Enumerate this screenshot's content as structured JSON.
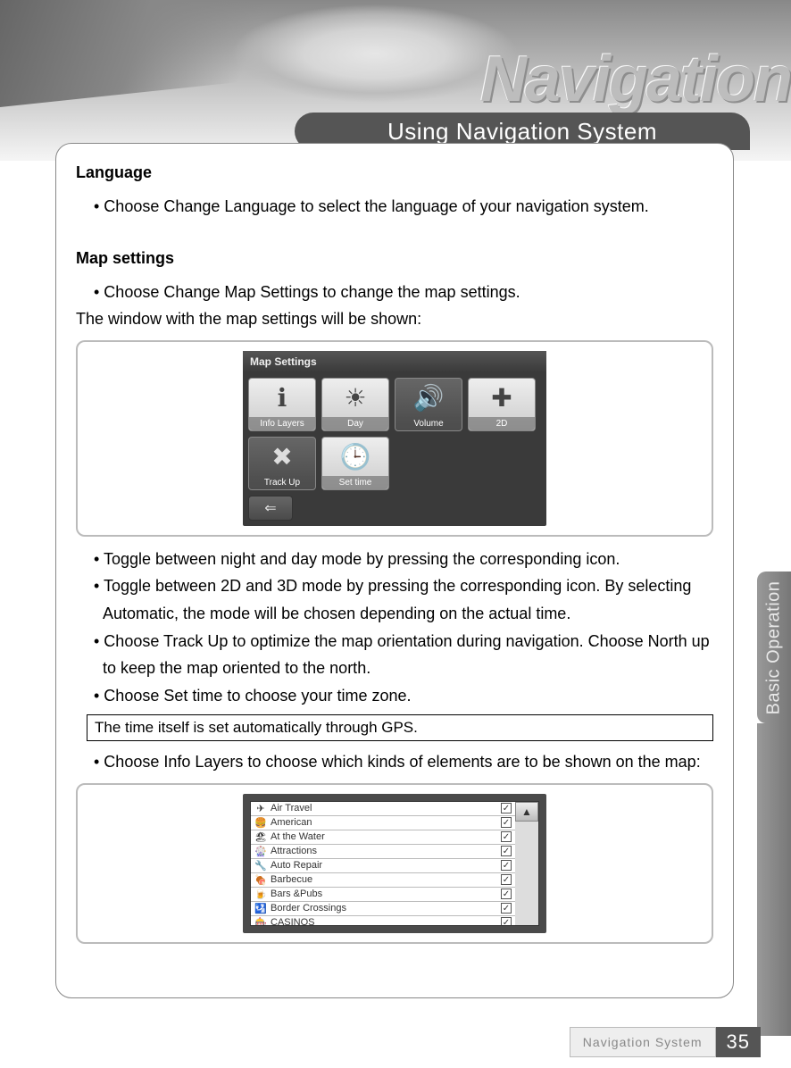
{
  "header": {
    "brand_word": "Navigation",
    "section_pill": "Using Navigation System"
  },
  "content": {
    "language": {
      "heading": "Language",
      "bullet1": "• Choose Change Language to select the language of your navigation system."
    },
    "map_settings": {
      "heading": "Map settings",
      "bullet1": "• Choose Change Map Settings to change the map settings.",
      "line1": "The window with the map settings will be shown:",
      "screenshot": {
        "title": "Map Settings",
        "tiles": [
          {
            "label": "Info Layers",
            "icon": "ℹ"
          },
          {
            "label": "Day",
            "icon": "☀"
          },
          {
            "label": "Volume",
            "icon": "🔊"
          },
          {
            "label": "2D",
            "icon": "✚"
          },
          {
            "label": "Track Up",
            "icon": "✖"
          },
          {
            "label": "Set time",
            "icon": "🕒"
          }
        ],
        "back_icon": "⇐"
      },
      "bullets_after": [
        "• Toggle between night and day mode by pressing the corresponding icon.",
        "• Toggle between 2D and 3D mode by pressing the corresponding icon.  By selecting Automatic, the mode will be chosen depending on the actual time.",
        "• Choose Track Up to optimize the map orientation during navigation. Choose North up to keep the map oriented to the north.",
        "• Choose Set time to choose your time zone."
      ],
      "note": "The time itself is set automatically through GPS.",
      "bullet_info_layers": "• Choose Info Layers to choose which kinds of elements are to be shown on the map:",
      "layer_list": [
        {
          "icon": "✈",
          "text": "Air Travel",
          "checked": true
        },
        {
          "icon": "🍔",
          "text": "American",
          "checked": true
        },
        {
          "icon": "🏖",
          "text": "At the Water",
          "checked": true
        },
        {
          "icon": "🎡",
          "text": "Attractions",
          "checked": true
        },
        {
          "icon": "🔧",
          "text": "Auto Repair",
          "checked": true
        },
        {
          "icon": "🍖",
          "text": "Barbecue",
          "checked": true
        },
        {
          "icon": "🍺",
          "text": "Bars &Pubs",
          "checked": true
        },
        {
          "icon": "🛂",
          "text": "Border Crossings",
          "checked": true
        },
        {
          "icon": "🎰",
          "text": "CASINOS",
          "checked": true
        }
      ]
    }
  },
  "side_tab": "Basic Operation",
  "footer": {
    "label": "Navigation System",
    "page": "35"
  }
}
